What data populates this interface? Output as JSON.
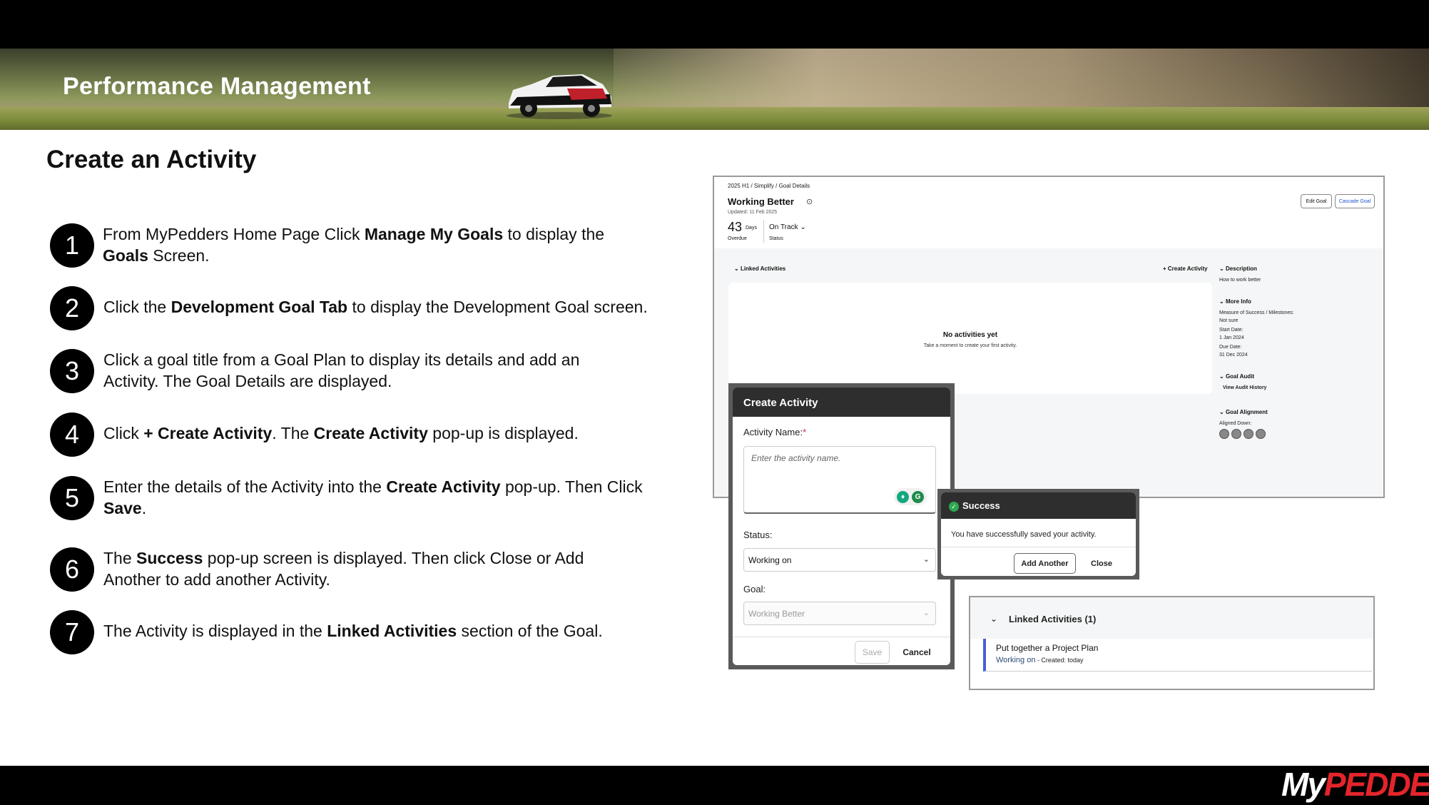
{
  "header": {
    "title": "Performance Management"
  },
  "page": {
    "title": "Create an Activity"
  },
  "steps": [
    {
      "num": "1",
      "parts": [
        "From MyPedders Home Page Click ",
        "Manage My Goals",
        " to display the ",
        "Goals",
        " Screen."
      ]
    },
    {
      "num": "2",
      "parts": [
        "Click the ",
        "Development Goal Tab",
        " to display the Development Goal screen."
      ]
    },
    {
      "num": "3",
      "text": "Click a goal title from a Goal Plan to display its details and add an Activity. The Goal Details are displayed."
    },
    {
      "num": "4",
      "parts": [
        "Click ",
        "+ Create Activity",
        ". The ",
        "Create Activity",
        " pop-up is displayed."
      ]
    },
    {
      "num": "5",
      "parts": [
        "Enter the details of the Activity into the ",
        "Create Activity",
        " pop-up. Then Click ",
        "Save",
        "."
      ]
    },
    {
      "num": "6",
      "parts": [
        "The ",
        "Success",
        " pop-up screen is displayed. Then click Close or Add Another to add another Activity."
      ]
    },
    {
      "num": "7",
      "parts": [
        "The Activity is displayed in the ",
        "Linked Activities",
        " section of the Goal."
      ]
    }
  ],
  "goal_screen": {
    "breadcrumb": "2025 H1 / Simplify / Goal Details",
    "title": "Working Better",
    "target_icon": "target-icon",
    "updated": "Updated: 11 Feb 2025",
    "days": "43",
    "days_label": "Days",
    "overdue": "Overdue",
    "status_value": "On Track",
    "status_label": "Status",
    "edit_goal": "Edit Goal",
    "cascade_goal": "Cascade Goal",
    "linked_activities": "Linked Activities",
    "create_activity": "+ Create Activity",
    "empty_title": "No activities yet",
    "empty_sub": "Take a moment to create your first activity.",
    "description_head": "Description",
    "description_value": "How to work better",
    "more_info_head": "More Info",
    "measure_label": "Measure of Success / Milestones:",
    "measure_value": "Not sure",
    "start_label": "Start Date:",
    "start_value": "1 Jan 2024",
    "due_label": "Due Date:",
    "due_value": "31 Dec 2024",
    "audit_head": "Goal Audit",
    "audit_link": "View Audit History",
    "alignment_head": "Goal Alignment",
    "aligned_down": "Aligned Down:"
  },
  "create_dialog": {
    "title": "Create Activity",
    "name_label": "Activity Name:",
    "required_mark": "*",
    "name_placeholder": "Enter the activity name.",
    "status_label": "Status:",
    "status_value": "Working on",
    "goal_label": "Goal:",
    "goal_value": "Working Better",
    "save": "Save",
    "cancel": "Cancel"
  },
  "success_dialog": {
    "title": "Success",
    "message": "You have successfully saved your activity.",
    "add_another": "Add Another",
    "close": "Close"
  },
  "linked_panel": {
    "title": "Linked Activities (1)",
    "item_title": "Put together a Project Plan",
    "item_status": "Working on",
    "item_meta": " - Created: today"
  },
  "footer": {
    "logo_my": "My",
    "logo_pedders": "PEDDERS"
  },
  "colors": {
    "accent_red": "#e3252b",
    "activity_border": "#4a5fd6",
    "success_green": "#2fa84f"
  }
}
